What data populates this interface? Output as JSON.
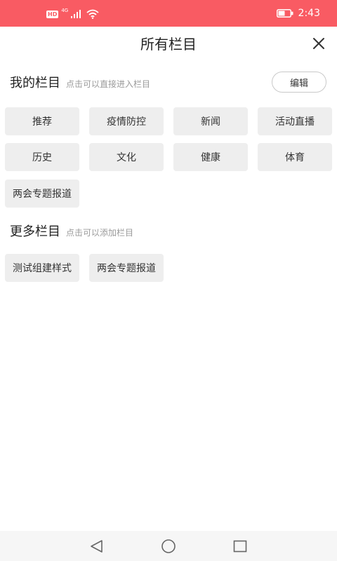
{
  "status_bar": {
    "hd_badge": "HD",
    "network": "4G",
    "time": "2:43",
    "icons": [
      "signal-bars-icon",
      "wifi-icon",
      "battery-icon"
    ]
  },
  "header": {
    "title": "所有栏目",
    "close_icon": "close-icon"
  },
  "my_columns": {
    "title": "我的栏目",
    "hint": "点击可以直接进入栏目",
    "edit_label": "编辑",
    "items": [
      {
        "label": "推荐"
      },
      {
        "label": "疫情防控"
      },
      {
        "label": "新闻"
      },
      {
        "label": "活动直播"
      },
      {
        "label": "历史"
      },
      {
        "label": "文化"
      },
      {
        "label": "健康"
      },
      {
        "label": "体育"
      },
      {
        "label": "两会专题报道"
      }
    ]
  },
  "more_columns": {
    "title": "更多栏目",
    "hint": "点击可以添加栏目",
    "items": [
      {
        "label": "测试组建样式"
      },
      {
        "label": "两会专题报道"
      }
    ]
  },
  "nav_bar": {
    "icons": [
      "back-triangle-icon",
      "home-circle-icon",
      "recents-square-icon"
    ]
  },
  "colors": {
    "status_bar": "#f95b63",
    "chip_background": "#eeeeee",
    "hint_text": "#9a9a9a"
  }
}
